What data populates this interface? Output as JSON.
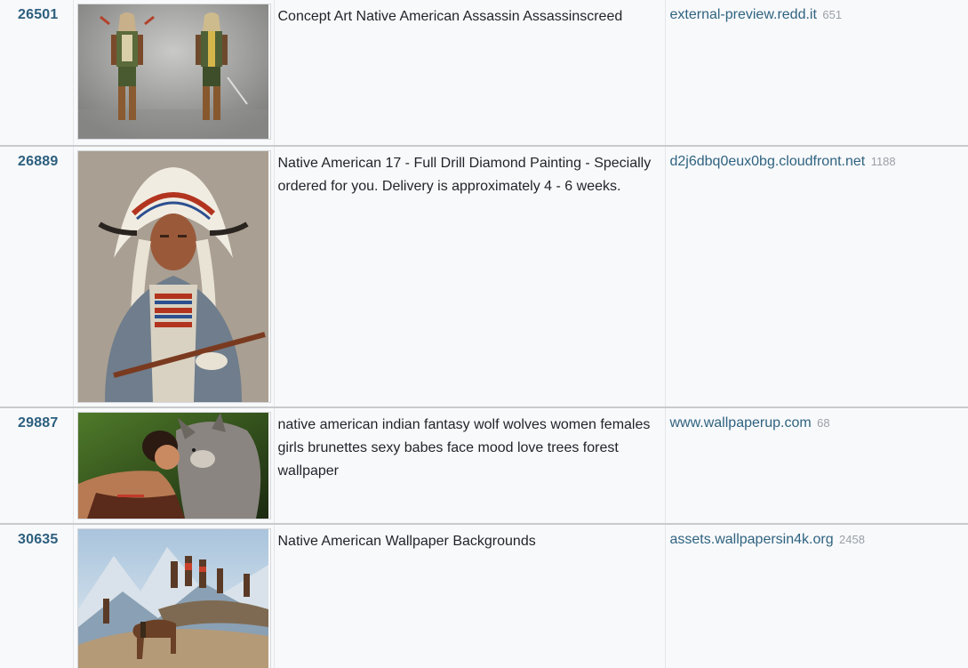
{
  "rows": [
    {
      "id": "26501",
      "title": "Concept Art Native American Assassin Assassinscreed",
      "source": "external-preview.redd.it",
      "count": "651",
      "image": "concept-art-assassin-image"
    },
    {
      "id": "26889",
      "title": "Native American 17 - Full Drill Diamond Painting - Specially ordered for you. Delivery is approximately 4 - 6 weeks.",
      "source": "d2j6dbq0eux0bg.cloudfront.net",
      "count": "1188",
      "image": "native-chief-portrait-image"
    },
    {
      "id": "29887",
      "title": "native american indian fantasy wolf wolves women females girls brunettes sexy babes face mood love trees forest wallpaper",
      "source": "www.wallpaperup.com",
      "count": "68",
      "image": "woman-wolf-image"
    },
    {
      "id": "30635",
      "title": "Native American Wallpaper Backgrounds",
      "source": "assets.wallpapersin4k.org",
      "count": "2458",
      "image": "mountain-riders-image"
    }
  ],
  "colors": {
    "id_link": "#2c5f7e",
    "source_link": "#2f6380",
    "count": "#9aa0a6",
    "row_bg": "#f8f9fb",
    "divider": "#c8cacc"
  }
}
